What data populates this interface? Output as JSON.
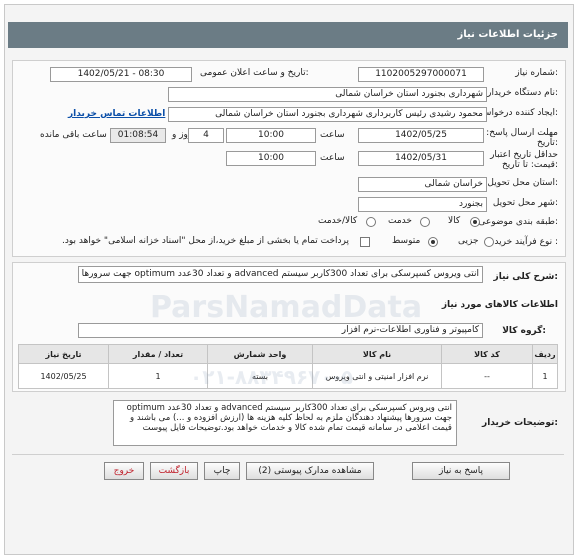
{
  "header": {
    "title": "جزئیات اطلاعات نیاز"
  },
  "fields": {
    "need_number_label": "شماره نیاز:",
    "need_number": "1102005297000071",
    "announce_label": "تاریخ و ساعت اعلان عمومی:",
    "announce_value": "1402/05/21 - 08:30",
    "buyer_label": "نام دستگاه خریدار:",
    "buyer": "شهرداری بجنورد استان خراسان شمالی",
    "creator_label": "ایجاد کننده درخواست:",
    "creator": "محمود رشیدی رئیس کاربرداری شهرداری بجنورد استان خراسان شمالی",
    "contact_link": "اطلاعات تماس خریدار",
    "reply_deadline_label": "مهلت ارسال پاسخ: تا تاریخ:",
    "reply_date": "1402/05/25",
    "time_label": "ساعت",
    "reply_time": "10:00",
    "days_value": "4",
    "days_label": "روز و",
    "remaining": "01:08:54",
    "remaining_label": "ساعت باقی مانده",
    "price_validity_label": "حداقل تاریخ اعتبار قیمت: تا تاریخ:",
    "validity_date": "1402/05/31",
    "validity_time": "10:00",
    "province_label": "استان محل تحویل:",
    "province": "خراسان شمالی",
    "city_label": "شهر محل تحویل:",
    "city": "بجنورد",
    "category_label": "طبقه بندی موضوعی:",
    "category_options": [
      "کالا",
      "خدمت",
      "کالا/خدمت"
    ],
    "process_label": "نوع فرآیند خرید :",
    "process_options": [
      "جزیی",
      "متوسط"
    ],
    "payment_note": "پرداخت تمام یا بخشی از مبلغ خرید،از محل \"اسناد خزانه اسلامی\" خواهد بود."
  },
  "summary": {
    "label": "شرح کلی نیاز:",
    "text": "انتی ویروس کسپرسکی برای تعداد 300کاربر سیستم advanced  و تعداد 30عدد optimum  جهت سرورها"
  },
  "goods": {
    "section_title": "اطلاعات کالاهای مورد نیاز",
    "group_label": "گروه کالا:",
    "group_value": "کامپیوتر و فناوری اطلاعات-نرم افزار",
    "columns": [
      "ردیف",
      "کد کالا",
      "نام کالا",
      "واحد شمارش",
      "تعداد / مقدار",
      "تاریخ نیاز"
    ],
    "rows": [
      {
        "row": "1",
        "code": "--",
        "name": "نرم افزار امنیتی و انتی ویروس",
        "unit": "بسته",
        "qty": "1",
        "date": "1402/05/25"
      }
    ]
  },
  "buyer_notes": {
    "label": "توضیحات خریدار:",
    "text": "انتی ویروس کسپرسکی برای تعداد 300کاربر سیستم advanced  و تعداد 30عدد optimum  جهت سرورها پیشنهاد دهندگان ملزم به لحاظ کلیه هزینه ها (ارزش افزوده و ...) می باشند و قیمت اعلامی در سامانه قیمت تمام شده کالا و خدمات خواهد بود.توضیحات فایل پیوست"
  },
  "buttons": {
    "reply": "پاسخ به نیاز",
    "attachments": "مشاهده مدارک پیوستی (2)",
    "print": "چاپ",
    "back": "بازگشت",
    "exit": "خروج"
  },
  "watermark": {
    "site": "ParsNamadData",
    "phone": "۰۲۱-۸۸۳۴۹۶۷۰-۵"
  }
}
